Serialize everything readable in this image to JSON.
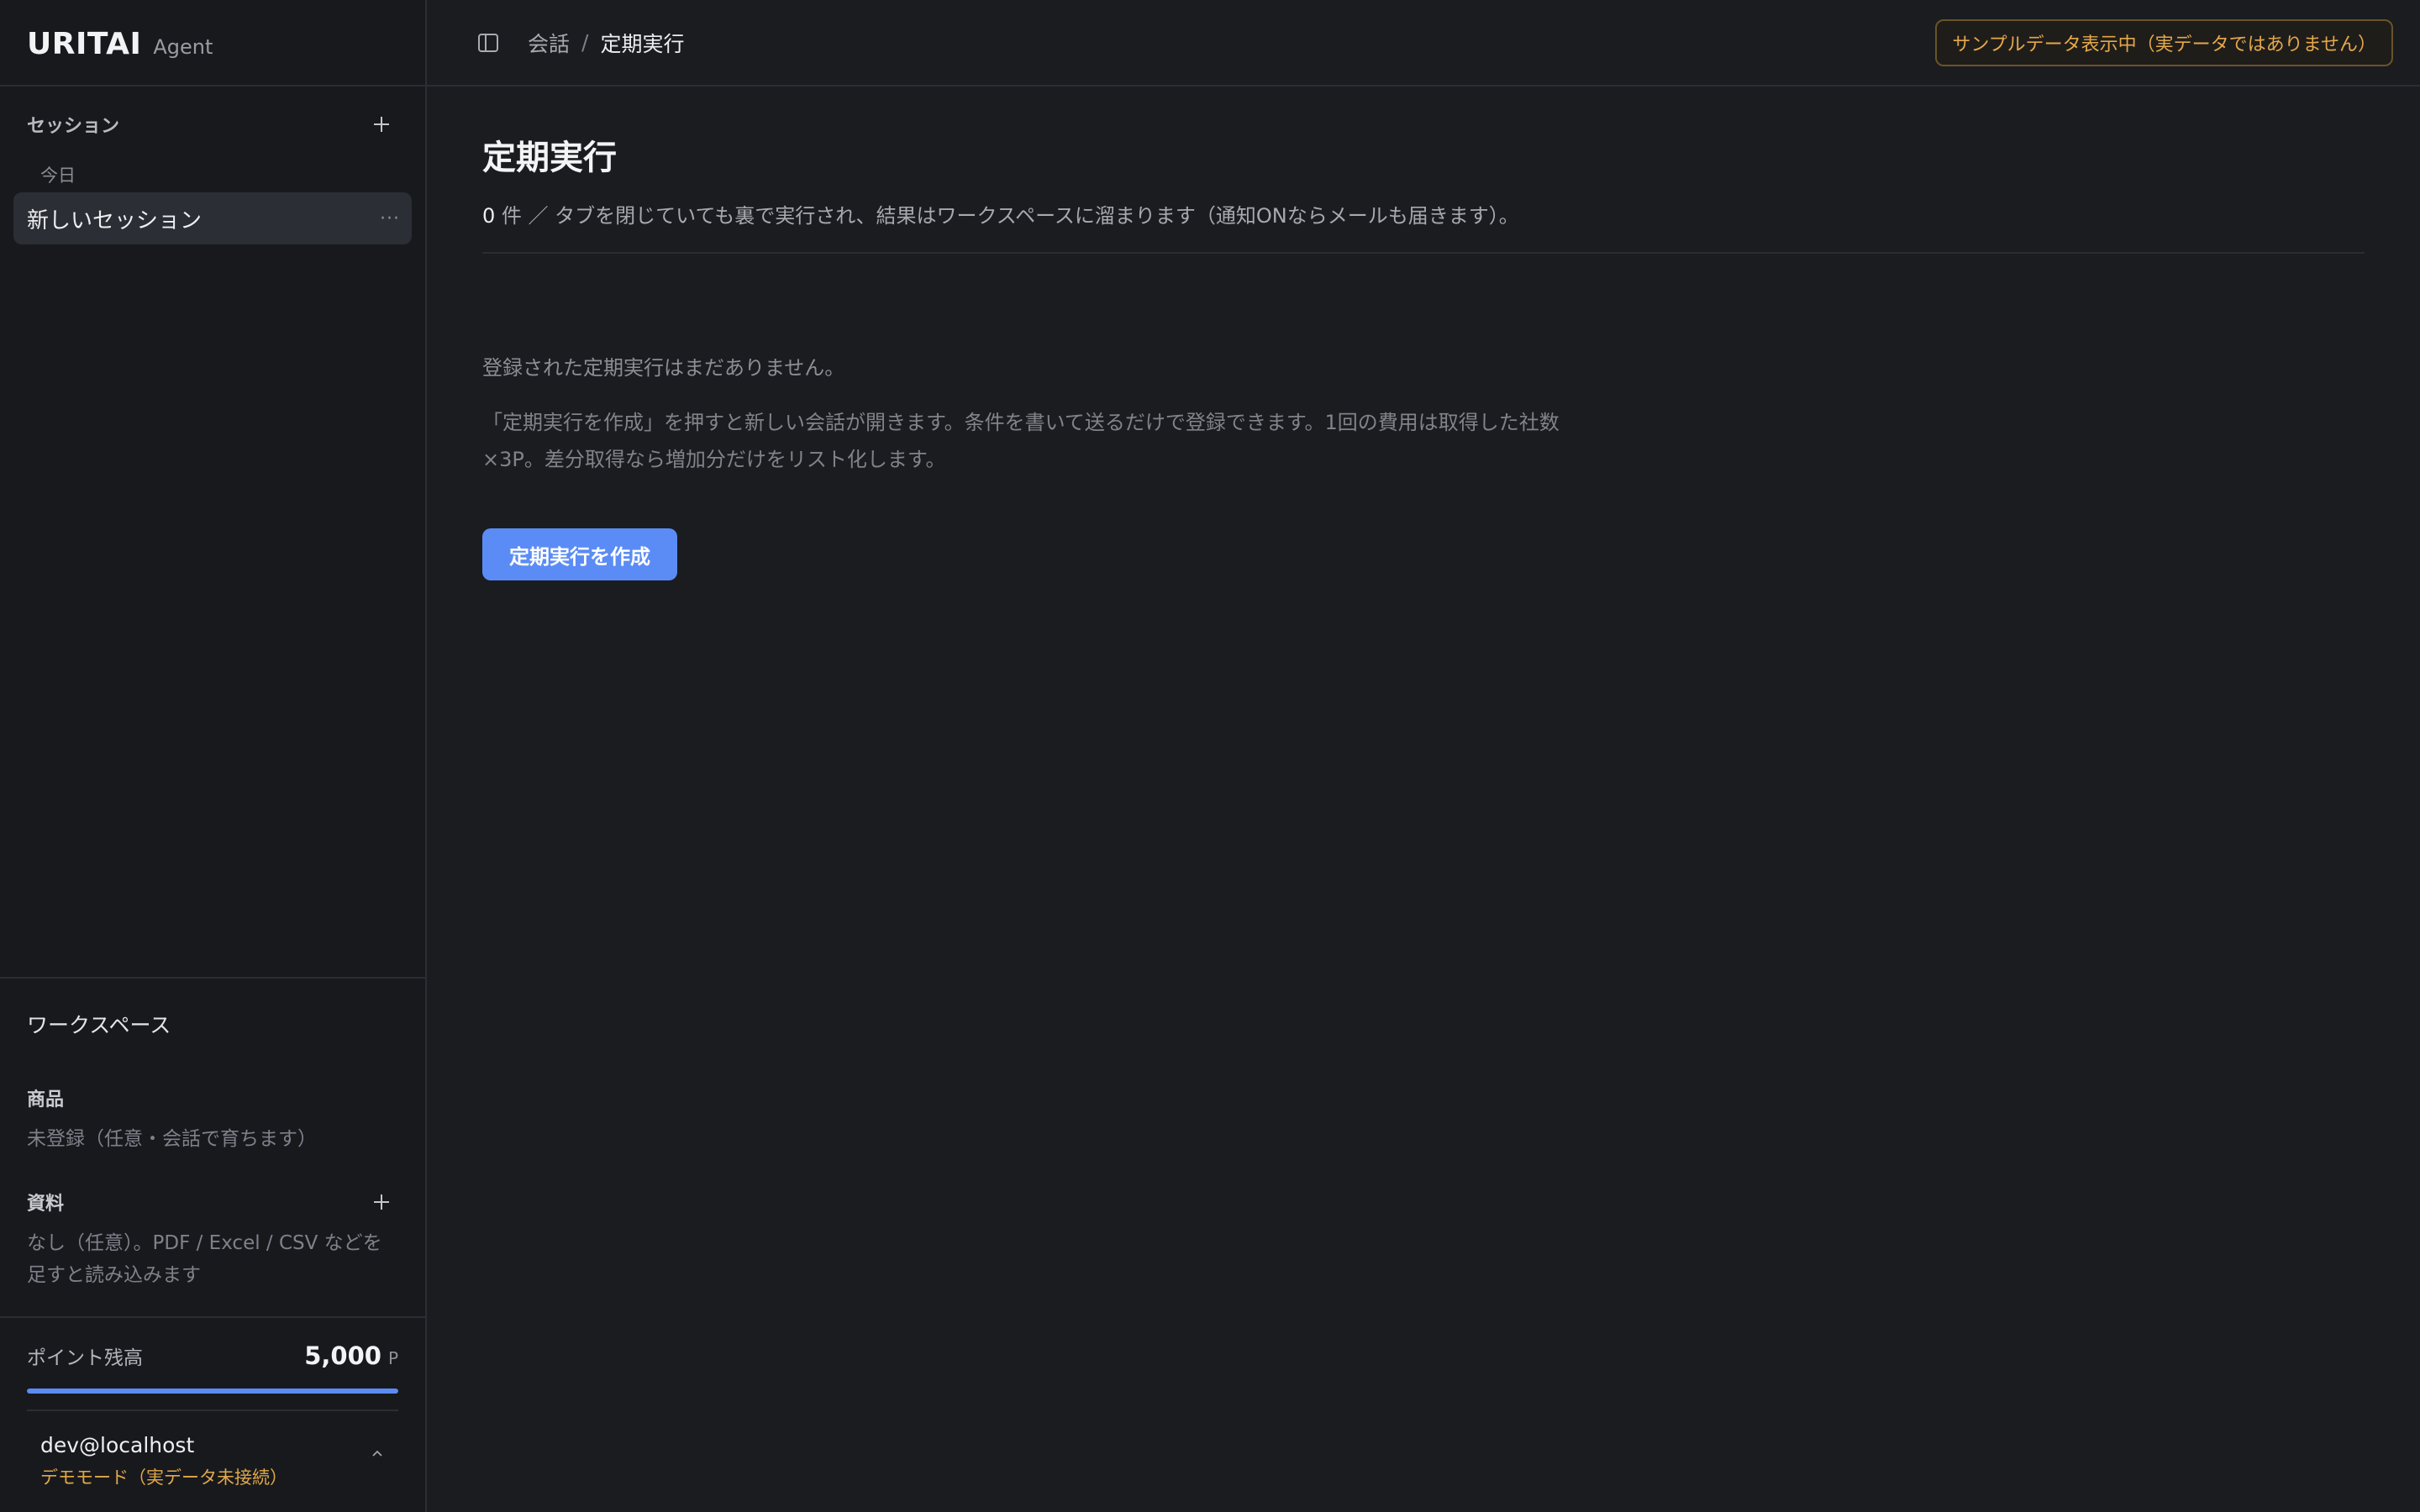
{
  "brand": {
    "name": "URITAI",
    "sub": "Agent"
  },
  "sidebar": {
    "sessions_title": "セッション",
    "group_label": "今日",
    "sessions": [
      {
        "label": "新しいセッション"
      }
    ]
  },
  "workspace": {
    "title": "ワークスペース",
    "products": {
      "title": "商品",
      "empty": "未登録（任意・会話で育ちます）"
    },
    "materials": {
      "title": "資料",
      "empty": "なし（任意）。PDF / Excel / CSV などを足すと読み込みます"
    }
  },
  "points": {
    "label": "ポイント残高",
    "value": "5,000",
    "unit": "P",
    "fill_fraction": 1.0
  },
  "user": {
    "email": "dev@localhost",
    "mode": "デモモード（実データ未接続）"
  },
  "breadcrumb": {
    "parent": "会話",
    "separator": "/",
    "current": "定期実行"
  },
  "badge": {
    "text": "サンプルデータ表示中（実データではありません）"
  },
  "main": {
    "title": "定期実行",
    "count": "0",
    "summary_rest": " 件 ／ タブを閉じていても裏で実行され、結果はワークスペースに溜まります（通知ONならメールも届きます）。",
    "empty_title": "登録された定期実行はまだありません。",
    "empty_desc": "「定期実行を作成」を押すと新しい会話が開きます。条件を書いて送るだけで登録できます。1回の費用は取得した社数×3P。差分取得なら増加分だけをリスト化します。",
    "create_button": "定期実行を作成"
  },
  "colors": {
    "accent": "#5b8cf5",
    "warning": "#e4a84a",
    "background": "#1b1c20",
    "sidebar": "#18191d"
  }
}
